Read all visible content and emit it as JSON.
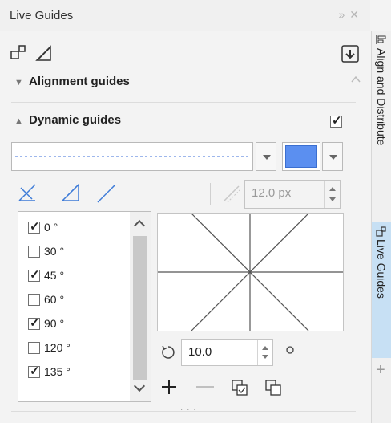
{
  "panel": {
    "title": "Live Guides",
    "sections": {
      "alignment": "Alignment guides",
      "dynamic": "Dynamic guides",
      "dynamic_enabled": true
    },
    "line_style": "dashed",
    "color": "#5b8ff0",
    "offset_value": "12.0 px",
    "angles": [
      {
        "label": "0 °",
        "checked": true
      },
      {
        "label": "30 °",
        "checked": false
      },
      {
        "label": "45 °",
        "checked": true
      },
      {
        "label": "60 °",
        "checked": false
      },
      {
        "label": "90 °",
        "checked": true
      },
      {
        "label": "120 °",
        "checked": false
      },
      {
        "label": "135 °",
        "checked": true
      }
    ],
    "rotation_value": "10.0"
  },
  "right_tabs": {
    "align": "Align and Distribute",
    "live": "Live Guides",
    "add": "+"
  }
}
